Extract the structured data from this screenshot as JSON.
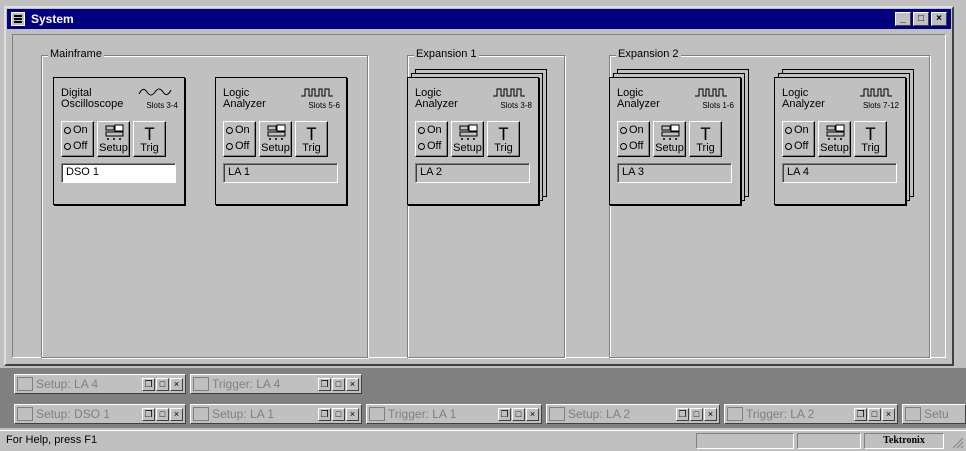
{
  "window": {
    "title": "System",
    "controls": {
      "minimize": "_",
      "maximize": "□",
      "close": "×"
    }
  },
  "groups": {
    "mainframe": "Mainframe",
    "expansion1": "Expansion 1",
    "expansion2": "Expansion 2"
  },
  "modules": [
    {
      "line1": "Digital",
      "line2": "Oscilloscope",
      "slots": "Slots 3-4",
      "on": "On",
      "off": "Off",
      "setup": "Setup",
      "trig": "Trig",
      "name": "DSO 1"
    },
    {
      "line1": "Logic",
      "line2": "Analyzer",
      "slots": "Slots 5-6",
      "on": "On",
      "off": "Off",
      "setup": "Setup",
      "trig": "Trig",
      "name": "LA 1"
    },
    {
      "line1": "Logic",
      "line2": "Analyzer",
      "slots": "Slots 3-8",
      "on": "On",
      "off": "Off",
      "setup": "Setup",
      "trig": "Trig",
      "name": "LA 2"
    },
    {
      "line1": "Logic",
      "line2": "Analyzer",
      "slots": "Slots 1-6",
      "on": "On",
      "off": "Off",
      "setup": "Setup",
      "trig": "Trig",
      "name": "LA 3"
    },
    {
      "line1": "Logic",
      "line2": "Analyzer",
      "slots": "Slots 7-12",
      "on": "On",
      "off": "Off",
      "setup": "Setup",
      "trig": "Trig",
      "name": "LA 4"
    }
  ],
  "minimized": {
    "row1": [
      "Setup: LA 4",
      "Trigger: LA 4"
    ],
    "row2": [
      "Setup: DSO 1",
      "Setup: LA 1",
      "Trigger: LA 1",
      "Setup: LA 2",
      "Trigger: LA 2",
      "Setu"
    ]
  },
  "status": {
    "help": "For Help, press F1",
    "brand": "Tektronix"
  },
  "colors": {
    "title_bar": "#000080",
    "face": "#c0c0c0",
    "mdi_bg": "#808080"
  }
}
